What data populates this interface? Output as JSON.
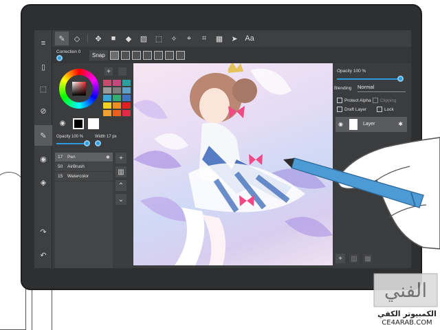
{
  "top_toolbar": {
    "text_tool_label": "Aa"
  },
  "sub_toolbar": {
    "correction_label": "Correction 0",
    "snap_label": "Snap"
  },
  "brush_panel": {
    "swatch_add": "+",
    "swatch_colors": [
      "#c84a6e",
      "#c6477a",
      "#2aa0a0",
      "#9a9a9a",
      "#7d7d7d",
      "#5fa0c8",
      "#3aa7d6",
      "#30b070",
      "#3e74c0",
      "#f0d020",
      "#f08c20",
      "#e02020",
      "#f0a030",
      "#e86020",
      "#e02848"
    ],
    "opacity_label": "Opacity 100 %",
    "width_label": "Width 17 px",
    "brushes": [
      {
        "size": "17",
        "name": "Pen",
        "selected": true
      },
      {
        "size": "50",
        "name": "AirBrush",
        "selected": false
      },
      {
        "size": "15",
        "name": "Watercolor",
        "selected": false
      }
    ],
    "add_label": "+"
  },
  "layer_panel": {
    "opacity_label": "Opacity 100 %",
    "blending_label": "Blending",
    "blending_value": "Normal",
    "protect_alpha_label": "Protect Alpha",
    "clipping_label": "Clipping",
    "draft_layer_label": "Draft Layer",
    "lock_label": "Lock",
    "layer_name": "Layer",
    "add_label": "+"
  },
  "watermark": {
    "logo_text": "الفني",
    "arabic_text": "الكمبيوتر الكفي",
    "url": "CE4ARAB.COM"
  },
  "accent_color": "#2d9be0"
}
